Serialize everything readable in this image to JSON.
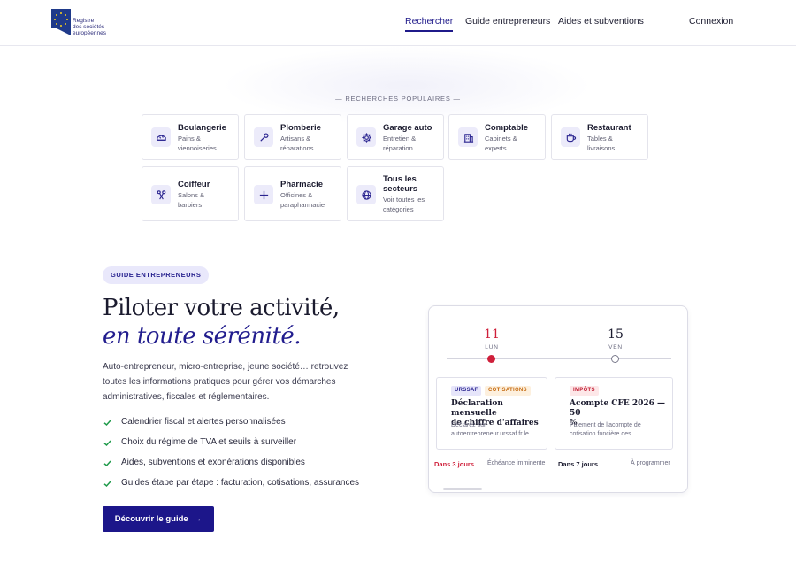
{
  "header": {
    "logo_text_line1": "Registre",
    "logo_text_line2": "des sociétés",
    "logo_text_line3": "européennes",
    "nav": [
      {
        "label": "Rechercher",
        "active": true
      },
      {
        "label": "Guide entrepreneurs",
        "active": false
      },
      {
        "label": "Aides et subventions",
        "active": false
      }
    ],
    "login_label": "Connexion"
  },
  "popular": {
    "title": "— RECHERCHES POPULAIRES —",
    "cards": [
      {
        "title": "Boulangerie",
        "sub1": "Pains &",
        "sub2": "viennoiseries",
        "sub3": "",
        "icon": "bread-icon"
      },
      {
        "title": "Plomberie",
        "sub1": "Artisans &",
        "sub2": "réparations",
        "sub3": "",
        "icon": "wrench-icon"
      },
      {
        "title": "Garage auto",
        "sub1": "Entretien &",
        "sub2": "réparation",
        "sub3": "",
        "icon": "gear-icon"
      },
      {
        "title": "Comptable",
        "sub1": "Cabinets &",
        "sub2": "experts",
        "sub3": "",
        "icon": "building-icon"
      },
      {
        "title": "Restaurant",
        "sub1": "Tables &",
        "sub2": "livraisons",
        "sub3": "",
        "icon": "cup-icon"
      },
      {
        "title": "Coiffeur",
        "sub1": "Salons &",
        "sub2": "barbiers",
        "sub3": "",
        "icon": "scissors-icon"
      },
      {
        "title": "Pharmacie",
        "sub1": "Officines &",
        "sub2": "parapharmacie",
        "sub3": "",
        "icon": "cross-icon"
      },
      {
        "title": "Tous les secteurs",
        "sub1": "Voir toutes les",
        "sub2": "catégories",
        "sub3": "",
        "icon": "globe-icon"
      }
    ]
  },
  "guide": {
    "badge": "GUIDE ENTREPRENEURS",
    "title": "Piloter votre activité,",
    "title_em": "en toute sérénité.",
    "intro": "Auto-entrepreneur, micro-entreprise, jeune société… retrouvez toutes les informations pratiques pour gérer vos démarches administratives, fiscales et réglementaires.",
    "checks": [
      "Calendrier fiscal et alertes personnalisées",
      "Choix du régime de TVA et seuils à surveiller",
      "Aides, subventions et exonérations disponibles",
      "Guides étape par étape : facturation, cotisations, assurances"
    ],
    "cta": "Découvrir le guide",
    "cta_arrow": "→"
  },
  "calendar": {
    "days": [
      {
        "num": "11",
        "dow": "LUN"
      },
      {
        "num": "15",
        "dow": "VEN"
      }
    ],
    "events": [
      {
        "tags": [
          "URSSAF",
          "COTISATIONS"
        ],
        "title_line1": "Déclaration mensuelle",
        "title_line2": "de chiffre d'affaires",
        "desc_line1": "Déclarez sur",
        "desc_line2": "autoentrepreneur.urssaf.fr le…",
        "due": "Dans 3 jours",
        "status": "Échéance imminente"
      },
      {
        "tags": [
          "IMPÔTS"
        ],
        "title_line1": "Acompte CFE 2026 — 50",
        "title_line2": "%",
        "desc_line1": "Paiement de l'acompte de",
        "desc_line2": "cotisation foncière des…",
        "due": "Dans 7 jours",
        "status": "À programmer"
      }
    ]
  },
  "colors": {
    "brand": "#1c168a",
    "accent_red": "#cf1f3a",
    "check_green": "#1f9a4a"
  }
}
